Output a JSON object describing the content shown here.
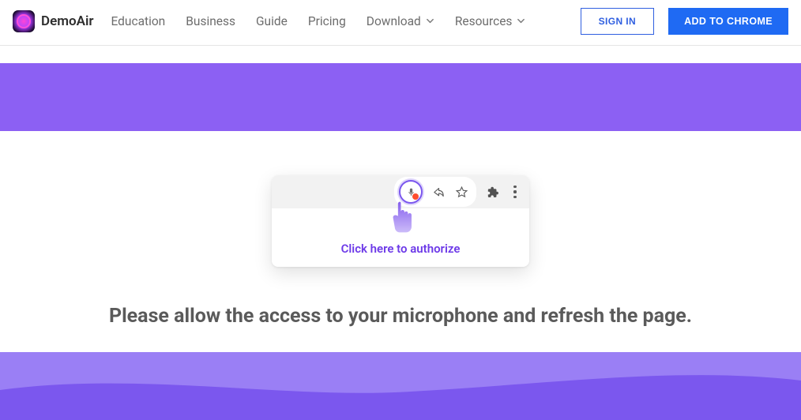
{
  "brand": {
    "name": "DemoAir"
  },
  "nav": {
    "education": "Education",
    "business": "Business",
    "guide": "Guide",
    "pricing": "Pricing",
    "download": "Download",
    "resources": "Resources"
  },
  "actions": {
    "signin": "SIGN IN",
    "add_chrome": "ADD TO CHROME"
  },
  "popup": {
    "authorize_link": "Click here to authorize"
  },
  "instruction": "Please allow the access to your microphone and refresh the page."
}
